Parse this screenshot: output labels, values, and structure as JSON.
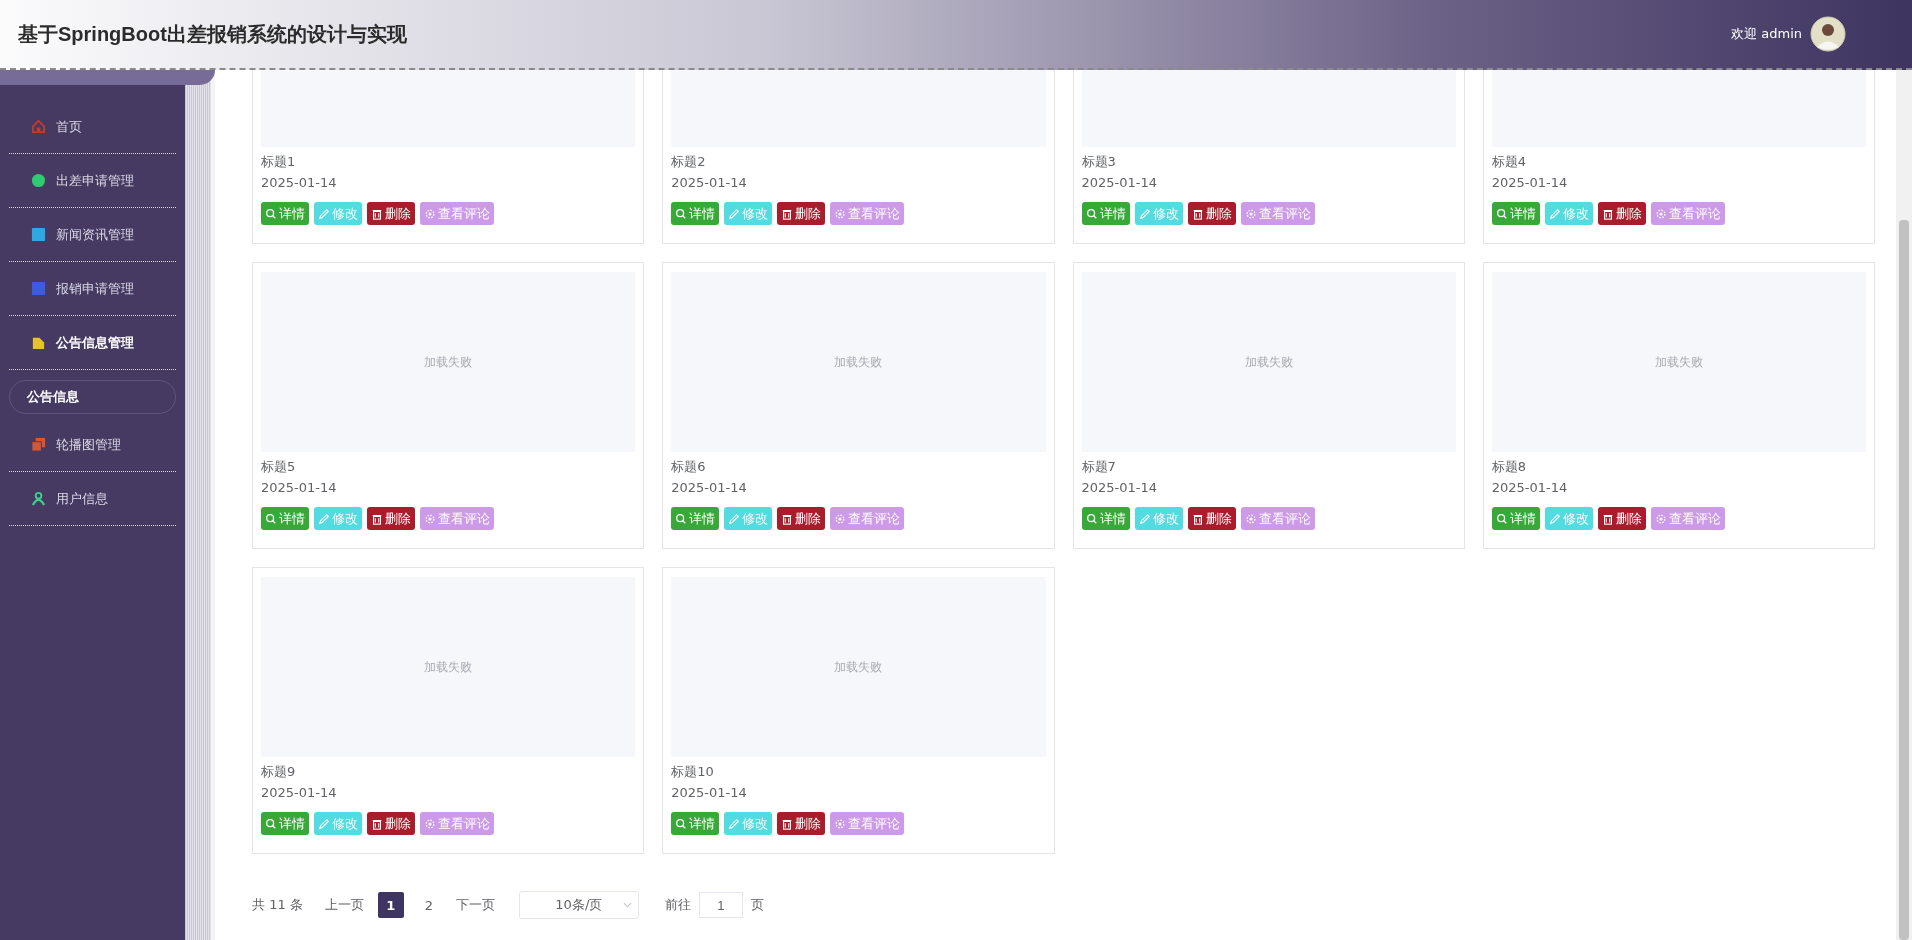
{
  "header": {
    "title": "基于SpringBoot出差报销系统的设计与实现",
    "welcome": "欢迎 admin"
  },
  "sidebar": {
    "items": [
      {
        "label": "首页",
        "kind": "home",
        "color": "#c0392b",
        "expanded": false
      },
      {
        "label": "出差申请管理",
        "kind": "dot",
        "color": "#2ecc71",
        "expanded": false
      },
      {
        "label": "新闻资讯管理",
        "kind": "square",
        "color": "#2ea8e0",
        "expanded": false
      },
      {
        "label": "报销申请管理",
        "kind": "square",
        "color": "#3d5be0",
        "expanded": false
      },
      {
        "label": "公告信息管理",
        "kind": "doc",
        "color": "#e5c12a",
        "expanded": true,
        "children": [
          {
            "label": "公告信息",
            "selected": true
          }
        ]
      },
      {
        "label": "轮播图管理",
        "kind": "layers",
        "color": "#d9552f",
        "expanded": false
      },
      {
        "label": "用户信息",
        "kind": "user",
        "color": "#3ccf8e",
        "expanded": false
      }
    ]
  },
  "cards": [
    {
      "title": "标题1",
      "date": "2025-01-14",
      "buttons": [
        {
          "kind": "detail",
          "label": "详情"
        },
        {
          "kind": "edit",
          "label": "修改"
        },
        {
          "kind": "delete",
          "label": "删除"
        },
        {
          "kind": "comments",
          "label": "查看评论"
        }
      ]
    },
    {
      "title": "标题2",
      "date": "2025-01-14",
      "buttons": [
        {
          "kind": "detail",
          "label": "详情"
        },
        {
          "kind": "edit",
          "label": "修改"
        },
        {
          "kind": "delete",
          "label": "删除"
        },
        {
          "kind": "comments",
          "label": "查看评论"
        }
      ]
    },
    {
      "title": "标题3",
      "date": "2025-01-14",
      "buttons": [
        {
          "kind": "detail",
          "label": "详情"
        },
        {
          "kind": "edit",
          "label": "修改"
        },
        {
          "kind": "delete",
          "label": "删除"
        },
        {
          "kind": "comments",
          "label": "查看评论"
        }
      ]
    },
    {
      "title": "标题4",
      "date": "2025-01-14",
      "buttons": [
        {
          "kind": "detail",
          "label": "详情"
        },
        {
          "kind": "edit",
          "label": "修改"
        },
        {
          "kind": "delete",
          "label": "删除"
        },
        {
          "kind": "comments",
          "label": "查看评论"
        }
      ]
    },
    {
      "image_text": "加载失败",
      "title": "标题5",
      "date": "2025-01-14",
      "buttons": [
        {
          "kind": "detail",
          "label": "详情"
        },
        {
          "kind": "edit",
          "label": "修改"
        },
        {
          "kind": "delete",
          "label": "删除"
        },
        {
          "kind": "comments",
          "label": "查看评论"
        }
      ]
    },
    {
      "image_text": "加载失败",
      "title": "标题6",
      "date": "2025-01-14",
      "buttons": [
        {
          "kind": "detail",
          "label": "详情"
        },
        {
          "kind": "edit",
          "label": "修改"
        },
        {
          "kind": "delete",
          "label": "删除"
        },
        {
          "kind": "comments",
          "label": "查看评论"
        }
      ]
    },
    {
      "image_text": "加载失败",
      "title": "标题7",
      "date": "2025-01-14",
      "buttons": [
        {
          "kind": "detail",
          "label": "详情"
        },
        {
          "kind": "edit",
          "label": "修改"
        },
        {
          "kind": "delete",
          "label": "删除"
        },
        {
          "kind": "comments",
          "label": "查看评论"
        }
      ]
    },
    {
      "image_text": "加载失败",
      "title": "标题8",
      "date": "2025-01-14",
      "buttons": [
        {
          "kind": "detail",
          "label": "详情"
        },
        {
          "kind": "edit",
          "label": "修改"
        },
        {
          "kind": "delete",
          "label": "删除"
        },
        {
          "kind": "comments",
          "label": "查看评论"
        }
      ]
    },
    {
      "image_text": "加载失败",
      "title": "标题9",
      "date": "2025-01-14",
      "buttons": [
        {
          "kind": "detail",
          "label": "详情"
        },
        {
          "kind": "edit",
          "label": "修改"
        },
        {
          "kind": "delete",
          "label": "删除"
        },
        {
          "kind": "comments",
          "label": "查看评论"
        }
      ]
    },
    {
      "image_text": "加载失败",
      "title": "标题10",
      "date": "2025-01-14",
      "buttons": [
        {
          "kind": "detail",
          "label": "详情"
        },
        {
          "kind": "edit",
          "label": "修改"
        },
        {
          "kind": "delete",
          "label": "删除"
        },
        {
          "kind": "comments",
          "label": "查看评论"
        }
      ]
    }
  ],
  "pagination": {
    "total": "共 11 条",
    "prev": "上一页",
    "pages": [
      {
        "label": "1",
        "selected": true
      },
      {
        "label": "2",
        "selected": false
      }
    ],
    "next": "下一页",
    "page_size": "10条/页",
    "goto_label": "前往",
    "goto_value": "1",
    "goto_suffix": "页"
  }
}
